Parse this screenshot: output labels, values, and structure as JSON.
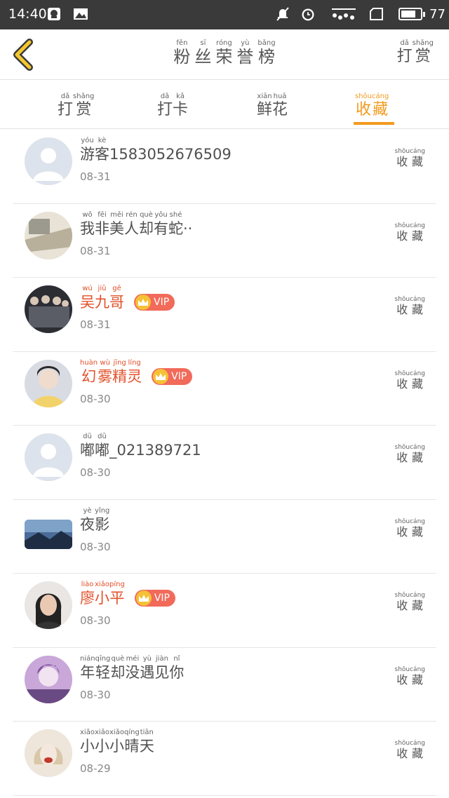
{
  "status_bar": {
    "time": "14:40",
    "battery_label": "77",
    "battery_level": 0.77,
    "icons": [
      "qq-icon",
      "image-icon",
      "mute-icon",
      "alarm-icon",
      "signal-icon",
      "sim-icon",
      "battery-icon"
    ]
  },
  "header": {
    "back_icon": "chevron-left-icon",
    "title": [
      {
        "hz": "粉",
        "py": "fěn"
      },
      {
        "hz": "丝",
        "py": "sī"
      },
      {
        "hz": "荣",
        "py": "róng"
      },
      {
        "hz": "誉",
        "py": "yù"
      },
      {
        "hz": "榜",
        "py": "bǎng"
      }
    ],
    "right_action": [
      {
        "hz": "打",
        "py": "dǎ"
      },
      {
        "hz": "赏",
        "py": "shǎng"
      }
    ]
  },
  "tabs": [
    {
      "chars": [
        {
          "hz": "打",
          "py": "dǎ"
        },
        {
          "hz": "赏",
          "py": "shǎng"
        }
      ],
      "active": false
    },
    {
      "chars": [
        {
          "hz": "打",
          "py": "dǎ"
        },
        {
          "hz": "卡",
          "py": "kǎ"
        }
      ],
      "active": false
    },
    {
      "chars": [
        {
          "hz": "鲜",
          "py": "xiān"
        },
        {
          "hz": "花",
          "py": "huā"
        }
      ],
      "active": false
    },
    {
      "chars": [
        {
          "hz": "收",
          "py": "shōu"
        },
        {
          "hz": "藏",
          "py": "cáng"
        }
      ],
      "active": true
    }
  ],
  "accent_color": "#f39a1e",
  "vip_color": "#e2502a",
  "vip_label": "VIP",
  "row_action": [
    {
      "hz": "收",
      "py": "shōu"
    },
    {
      "hz": "藏",
      "py": "cáng"
    }
  ],
  "list": [
    {
      "name": [
        {
          "hz": "游",
          "py": "yóu"
        },
        {
          "hz": "客",
          "py": "kè"
        }
      ],
      "suffix": "15830526765​09",
      "date": "08-31",
      "vip": false,
      "avatar": "default-avatar"
    },
    {
      "name": [
        {
          "hz": "我",
          "py": "wǒ"
        },
        {
          "hz": "非",
          "py": "fēi"
        },
        {
          "hz": "美",
          "py": "měi"
        },
        {
          "hz": "人",
          "py": "rén"
        },
        {
          "hz": "却",
          "py": "què"
        },
        {
          "hz": "有",
          "py": "yǒu"
        },
        {
          "hz": "蛇",
          "py": "shé"
        }
      ],
      "suffix": "··",
      "date": "08-31",
      "vip": false,
      "avatar": "photo-avatar"
    },
    {
      "name": [
        {
          "hz": "吴",
          "py": "wú"
        },
        {
          "hz": "九",
          "py": "jiǔ"
        },
        {
          "hz": "哥",
          "py": "gē"
        }
      ],
      "suffix": "",
      "date": "08-31",
      "vip": true,
      "avatar": "group-photo-avatar"
    },
    {
      "name": [
        {
          "hz": "幻",
          "py": "huàn"
        },
        {
          "hz": "雾",
          "py": "wù"
        },
        {
          "hz": "精",
          "py": "jīng"
        },
        {
          "hz": "灵",
          "py": "líng"
        }
      ],
      "suffix": "",
      "date": "08-30",
      "vip": true,
      "avatar": "selfie-avatar"
    },
    {
      "name": [
        {
          "hz": "嘟",
          "py": "dū"
        },
        {
          "hz": "嘟",
          "py": "dū"
        }
      ],
      "suffix": "_021389721",
      "date": "08-30",
      "vip": false,
      "avatar": "default-avatar"
    },
    {
      "name": [
        {
          "hz": "夜",
          "py": "yè"
        },
        {
          "hz": "影",
          "py": "yǐng"
        }
      ],
      "suffix": "",
      "date": "08-30",
      "vip": false,
      "avatar": "landscape-avatar"
    },
    {
      "name": [
        {
          "hz": "廖",
          "py": "liào"
        },
        {
          "hz": "小",
          "py": "xiǎo"
        },
        {
          "hz": "平",
          "py": "píng"
        }
      ],
      "suffix": "",
      "date": "08-30",
      "vip": true,
      "avatar": "portrait-avatar"
    },
    {
      "name": [
        {
          "hz": "年",
          "py": "nián"
        },
        {
          "hz": "轻",
          "py": "qīng"
        },
        {
          "hz": "却",
          "py": "què"
        },
        {
          "hz": "没",
          "py": "méi"
        },
        {
          "hz": "遇",
          "py": "yù"
        },
        {
          "hz": "见",
          "py": "jiàn"
        },
        {
          "hz": "你",
          "py": "nǐ"
        }
      ],
      "suffix": "",
      "date": "08-30",
      "vip": false,
      "avatar": "purple-avatar"
    },
    {
      "name": [
        {
          "hz": "小",
          "py": "xiǎo"
        },
        {
          "hz": "小",
          "py": "xiǎo"
        },
        {
          "hz": "小",
          "py": "xiǎo"
        },
        {
          "hz": "晴",
          "py": "qíng"
        },
        {
          "hz": "天",
          "py": "tiān"
        }
      ],
      "suffix": "",
      "date": "08-29",
      "vip": false,
      "avatar": "doll-avatar"
    }
  ]
}
